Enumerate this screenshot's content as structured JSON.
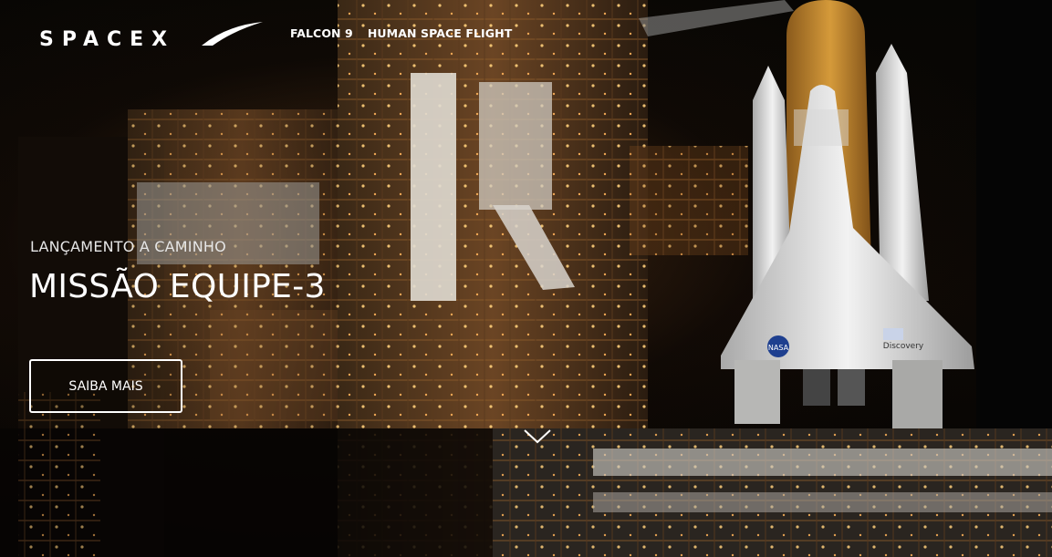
{
  "header": {
    "logo_text": "SPACEX",
    "nav": [
      {
        "label": "FALCON 9"
      },
      {
        "label": "HUMAN SPACE FLIGHT"
      }
    ]
  },
  "hero": {
    "subtitle": "LANÇAMENTO A CAMINHO",
    "title": "MISSÃO EQUIPE-3",
    "cta_label": "SAIBA MAIS",
    "background_description_icon": "launch-pad-shuttle-image",
    "shuttle_text": {
      "agency": "NASA",
      "orbiter": "Discovery"
    }
  },
  "colors": {
    "text": "#ffffff",
    "background": "#050505",
    "tower_glow": "#c67a2e",
    "external_tank": "#c98a2c",
    "shuttle_white": "#e8e8e8"
  },
  "icons": {
    "scroll": "chevron-down-icon"
  }
}
